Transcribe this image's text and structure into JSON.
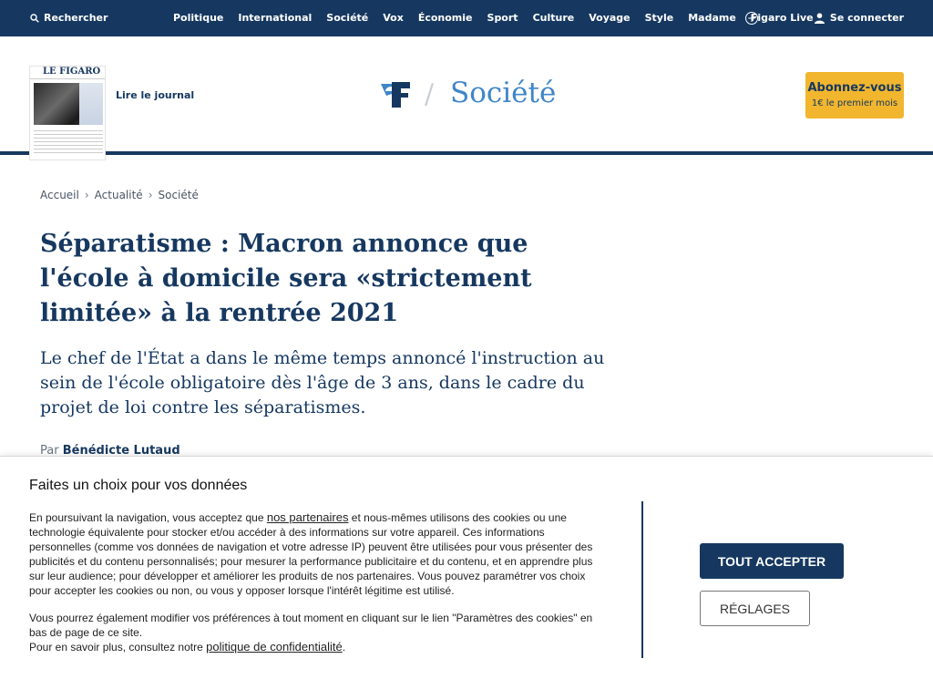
{
  "topnav": {
    "search_label": "Rechercher",
    "links": [
      "Politique",
      "International",
      "Société",
      "Vox",
      "Économie",
      "Sport",
      "Culture",
      "Voyage",
      "Style",
      "Madame",
      "Figaro Live"
    ],
    "login_label": "Se connecter",
    "background": "#163860"
  },
  "header": {
    "journal_mast": "LE FIGARO",
    "read_journal": "Lire le journal",
    "section": "Société",
    "subscribe_title": "Abonnez-vous",
    "subscribe_sub": "1€ le premier mois",
    "accent": "#3f86c9",
    "cta_color": "#f1b62e"
  },
  "breadcrumb": [
    "Accueil",
    "Actualité",
    "Société"
  ],
  "article": {
    "title": "Séparatisme : Macron annonce que l'école à domicile sera «strictement limitée» à la rentrée 2021",
    "lead": "Le chef de l'État a dans le même temps annoncé l'instruction au sein de l'école obligatoire dès l'âge de 3 ans, dans le cadre du projet de loi contre les séparatismes.",
    "byline_prefix": "Par",
    "author": "Bénédicte Lutaud"
  },
  "consent": {
    "title": "Faites un choix pour vos données",
    "p1_before": "En poursuivant la navigation, vous acceptez que ",
    "p1_link": "nos partenaires",
    "p1_after": " et nous-mêmes utilisons des cookies ou une technologie équivalente pour stocker et/ou accéder à des informations sur votre appareil. Ces informations personnelles (comme vos données de navigation et votre adresse IP) peuvent être utilisées pour vous présenter des publicités et du contenu personnalisés; pour mesurer la performance publicitaire et du contenu, et en apprendre plus sur leur audience; pour développer et améliorer les produits de nos partenaires. Vous pouvez paramétrer vos choix pour accepter les cookies ou non, ou vous y opposer lorsque l'intérêt légitime est utilisé.",
    "p2": "Vous pourrez également modifier vos préférences à tout moment en cliquant sur le lien \"Paramètres des cookies\" en bas de page de ce site.",
    "p3_before": "Pour en savoir plus, consultez notre ",
    "p3_link": "politique de confidentialité",
    "p3_after": ".",
    "accept_label": "TOUT ACCEPTER",
    "settings_label": "RÉGLAGES"
  }
}
